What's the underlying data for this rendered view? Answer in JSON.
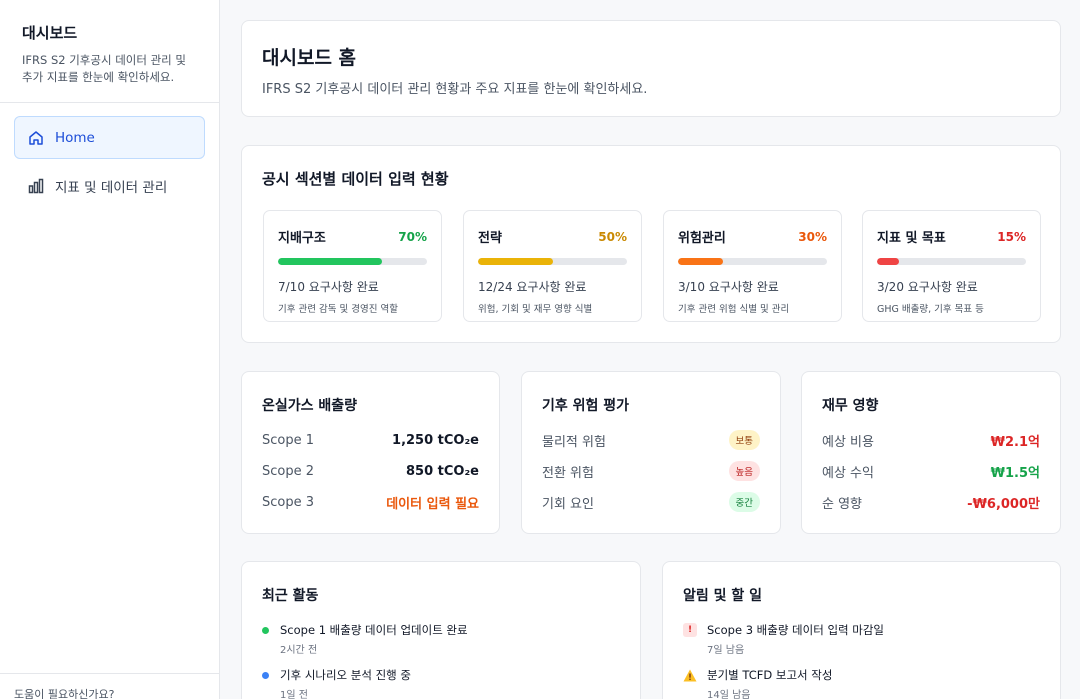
{
  "sidebar": {
    "title": "대시보드",
    "subtitle": "IFRS S2 기후공시 데이터 관리 및 추가 지표를 한눈에 확인하세요.",
    "nav": [
      {
        "label": "Home",
        "icon": "home-icon",
        "active": true
      },
      {
        "label": "지표 및 데이터 관리",
        "icon": "bar-chart-icon",
        "active": false
      }
    ],
    "footer": "도움이 필요하신가요?"
  },
  "header": {
    "title": "대시보드 홈",
    "subtitle": "IFRS S2 기후공시 데이터 관리 현황과 주요 지표를 한눈에 확인하세요."
  },
  "sections": {
    "title": "공시 섹션별 데이터 입력 현황",
    "items": [
      {
        "name": "지배구조",
        "percent": "70%",
        "progress": 0.7,
        "color": "#22c55e",
        "count": "7/10 요구사항 완료",
        "desc": "기후 관련 감독 및 경영진 역할"
      },
      {
        "name": "전략",
        "percent": "50%",
        "progress": 0.5,
        "color": "#eab308",
        "count": "12/24 요구사항 완료",
        "desc": "위험, 기회 및 재무 영향 식별"
      },
      {
        "name": "위험관리",
        "percent": "30%",
        "progress": 0.3,
        "color": "#f97316",
        "count": "3/10 요구사항 완료",
        "desc": "기후 관련 위험 식별 및 관리"
      },
      {
        "name": "지표 및 목표",
        "percent": "15%",
        "progress": 0.15,
        "color": "#ef4444",
        "count": "3/20 요구사항 완료",
        "desc": "GHG 배출량, 기후 목표 등"
      }
    ]
  },
  "ghg": {
    "title": "온실가스 배출량",
    "rows": [
      {
        "label": "Scope 1",
        "value": "1,250 tCO₂e",
        "color": "#111827"
      },
      {
        "label": "Scope 2",
        "value": "850 tCO₂e",
        "color": "#111827"
      },
      {
        "label": "Scope 3",
        "value": "데이터 입력 필요",
        "color": "#ea580c"
      }
    ]
  },
  "risk": {
    "title": "기후 위험 평가",
    "rows": [
      {
        "label": "물리적 위험",
        "badge": "보통",
        "bg": "#fef3c7",
        "fg": "#92400e"
      },
      {
        "label": "전환 위험",
        "badge": "높음",
        "bg": "#fee2e2",
        "fg": "#b91c1c"
      },
      {
        "label": "기회 요인",
        "badge": "중간",
        "bg": "#dcfce7",
        "fg": "#15803d"
      }
    ]
  },
  "finance": {
    "title": "재무 영향",
    "rows": [
      {
        "label": "예상 비용",
        "value": "₩2.1억",
        "color": "#dc2626"
      },
      {
        "label": "예상 수익",
        "value": "₩1.5억",
        "color": "#16a34a"
      },
      {
        "label": "순 영향",
        "value": "-₩6,000만",
        "color": "#dc2626"
      }
    ]
  },
  "activity": {
    "title": "최근 활동",
    "items": [
      {
        "text": "Scope 1 배출량 데이터 업데이트 완료",
        "time": "2시간 전",
        "color": "#22c55e"
      },
      {
        "text": "기후 시나리오 분석 진행 중",
        "time": "1일 전",
        "color": "#3b82f6"
      }
    ]
  },
  "alerts": {
    "title": "알림 및 할 일",
    "items": [
      {
        "text": "Scope 3 배출량 데이터 입력 마감일",
        "time": "7일 남음",
        "icon": "exclamation-icon",
        "symbol": "!",
        "bg": "#fee2e2",
        "fg": "#dc2626"
      },
      {
        "text": "분기별 TCFD 보고서 작성",
        "time": "14일 남음",
        "icon": "warning-icon",
        "symbol": "!",
        "bg": "#fde68a",
        "fg": "#b45309"
      }
    ]
  }
}
